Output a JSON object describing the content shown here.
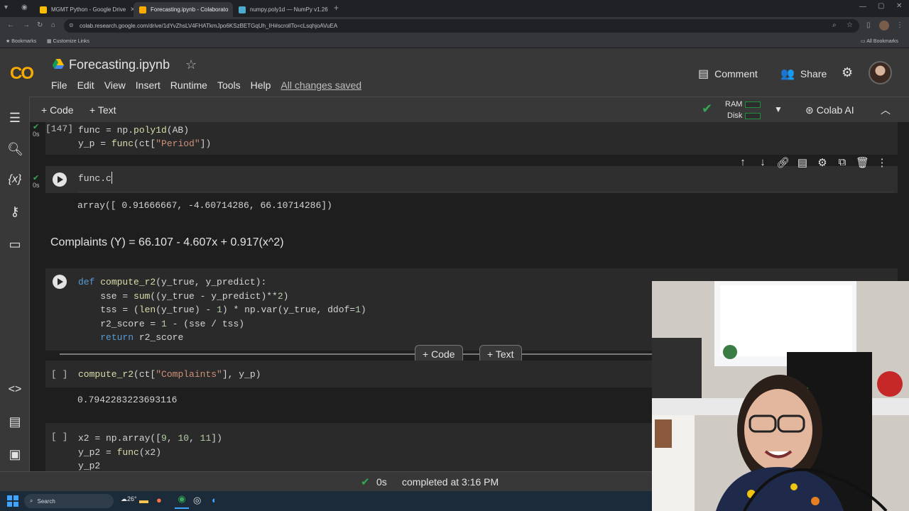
{
  "browser": {
    "tabs": [
      {
        "label": "MGMT Python - Google Drive",
        "active": false
      },
      {
        "label": "Forecasting.ipynb - Colaborato",
        "active": true
      },
      {
        "label": "numpy.poly1d — NumPy v1.26",
        "active": false
      }
    ],
    "url": "colab.research.google.com/drive/1dYvZhsLV4FHATkmJpo6KSzBETGqUh_IH#scrollTo=cLsqhjoAVuEA",
    "bookmarks": {
      "item1": "Bookmarks",
      "item2": "Customize Links",
      "all": "All Bookmarks"
    }
  },
  "colab": {
    "logo": "CO",
    "title": "Forecasting.ipynb",
    "menu": [
      "File",
      "Edit",
      "View",
      "Insert",
      "Runtime",
      "Tools",
      "Help"
    ],
    "save_status": "All changes saved",
    "comment": "Comment",
    "share": "Share"
  },
  "toolbar": {
    "code": "+ Code",
    "text": "+ Text",
    "ram": "RAM",
    "disk": "Disk",
    "colab_ai": "Colab AI"
  },
  "cells": {
    "c1": {
      "exec": "[147]",
      "time": "0s"
    },
    "c2": {
      "time": "0s",
      "code": "func.c",
      "output": "array([ 0.91666667, -4.60714286, 66.10714286])"
    },
    "text1": "Complaints (Y) = 66.107 - 4.607x + 0.917(x^2)",
    "c4": {
      "exec": "[ ]",
      "output": "0.7942283223693116"
    },
    "c5": {
      "exec": "[ ]"
    }
  },
  "float_buttons": {
    "code": "+ Code",
    "text": "+ Text"
  },
  "status": {
    "time": "0s",
    "message": "completed at 3:16 PM"
  },
  "taskbar": {
    "search": "Search",
    "temp": "26°"
  }
}
